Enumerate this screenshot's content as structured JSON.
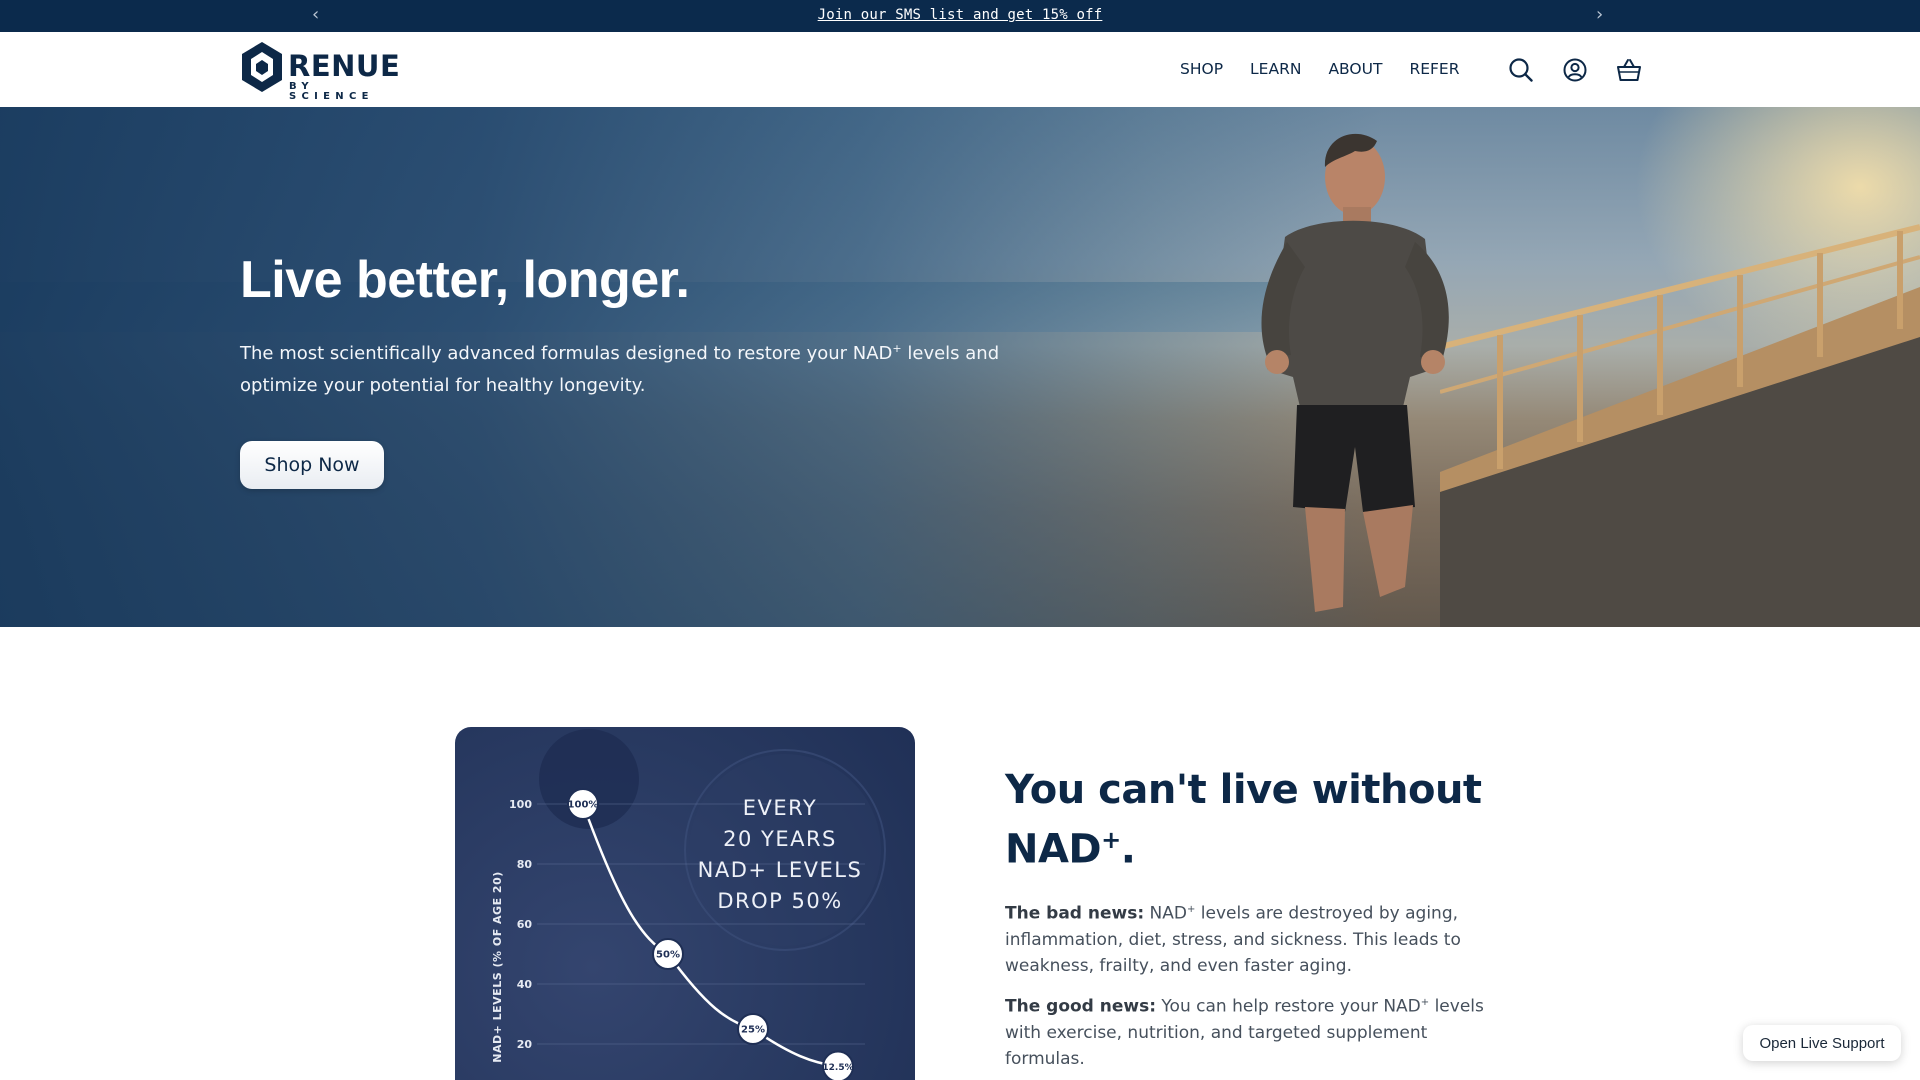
{
  "announcement": {
    "text": "Join our SMS list and get 15% off",
    "prev_arrow": "‹",
    "next_arrow": "›"
  },
  "brand": {
    "name": "RENUE",
    "tagline": "BY SCIENCE",
    "color": "#0d2847"
  },
  "nav": {
    "items": [
      "SHOP",
      "LEARN",
      "ABOUT",
      "REFER"
    ],
    "icons": [
      "search-icon",
      "account-icon",
      "cart-icon"
    ]
  },
  "hero": {
    "title": "Live better, longer.",
    "subtitle_part1": "The most scientifically advanced formulas designed to restore your NAD",
    "subtitle_sup": "+",
    "subtitle_part2": " levels and optimize your potential for healthy longevity.",
    "cta_label": "Shop Now"
  },
  "chart_data": {
    "type": "line",
    "title_lines": [
      "EVERY",
      "20 YEARS",
      "NAD+ LEVELS",
      "DROP 50%"
    ],
    "ylabel": "NAD+ LEVELS (% OF AGE 20)",
    "xlabel": "",
    "ylim": [
      0,
      100
    ],
    "y_ticks": [
      "100",
      "80",
      "60",
      "40",
      "20"
    ],
    "y_tick_values": [
      100,
      80,
      60,
      40,
      20
    ],
    "points": [
      {
        "x": 20,
        "y": 100,
        "label": "100%"
      },
      {
        "x": 40,
        "y": 50,
        "label": "50%"
      },
      {
        "x": 60,
        "y": 25,
        "label": "25%"
      },
      {
        "x": 80,
        "y": 12.5,
        "label": "12.5%"
      }
    ]
  },
  "nad_section": {
    "title_line1": "You can't live without",
    "title_line2": "NAD",
    "title_sup": "+",
    "title_end": ".",
    "bad_label": "The bad news:",
    "bad_part1": " NAD",
    "bad_sup": "+",
    "bad_part2": " levels are destroyed by aging, inflammation, diet, stress, and sickness. This leads to weakness, frailty, and even faster aging.",
    "good_label": "The good news:",
    "good_part1": " You can help restore your NAD",
    "good_sup": "+",
    "good_part2": " levels with exercise, nutrition, and targeted supplement formulas."
  },
  "support": {
    "label": "Open Live Support"
  }
}
